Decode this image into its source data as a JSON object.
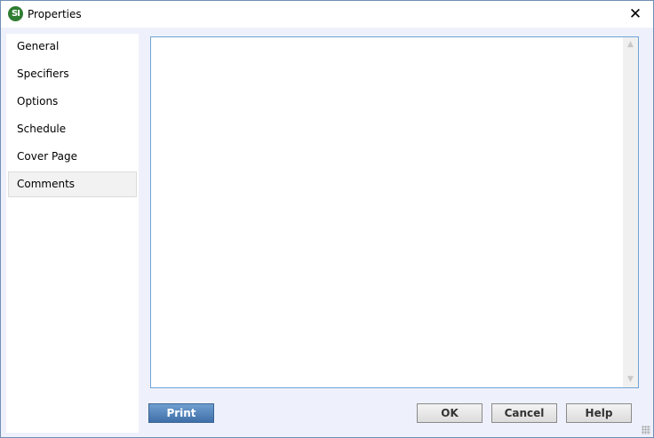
{
  "window": {
    "title": "Properties",
    "app_icon_text": "SI",
    "close_glyph": "✕"
  },
  "sidebar": {
    "items": [
      {
        "label": "General"
      },
      {
        "label": "Specifiers"
      },
      {
        "label": "Options"
      },
      {
        "label": "Schedule"
      },
      {
        "label": "Cover Page"
      },
      {
        "label": "Comments",
        "selected": true
      }
    ]
  },
  "comments": {
    "text": "",
    "scroll_up_glyph": "▲",
    "scroll_down_glyph": "▼"
  },
  "buttons": {
    "print": "Print",
    "ok": "OK",
    "cancel": "Cancel",
    "help": "Help"
  },
  "colors": {
    "accent": "#4a7bb7",
    "dialog_background": "#eef1fb",
    "app_icon": "#2f7d32"
  }
}
